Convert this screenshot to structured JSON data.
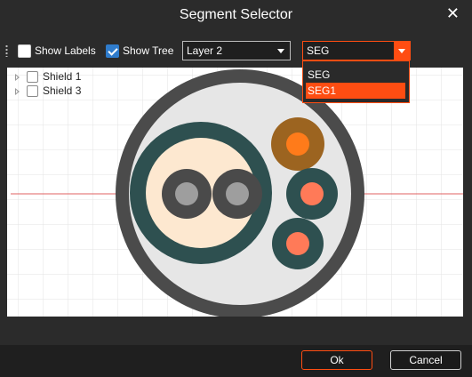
{
  "dialog": {
    "title": "Segment Selector"
  },
  "toolbar": {
    "show_labels": {
      "label": "Show Labels",
      "checked": false
    },
    "show_tree": {
      "label": "Show Tree",
      "checked": true
    },
    "layer_select": {
      "value": "Layer 2"
    },
    "segment_select": {
      "value": "SEG",
      "options": [
        "SEG",
        "SEG1"
      ],
      "highlighted": "SEG1"
    }
  },
  "tree": {
    "items": [
      {
        "label": "Shield 1",
        "checked": false
      },
      {
        "label": "Shield 3",
        "checked": false
      }
    ]
  },
  "footer": {
    "ok_label": "Ok",
    "cancel_label": "Cancel"
  },
  "colors": {
    "accent": "#ff4d12",
    "outer_jacket": "#4b4b4b",
    "inner_fill": "#e6e6e6",
    "shield_ring": "#2e5050",
    "pair_core_fill": "#fde8d0",
    "conductor_outer": "#4a4a4a",
    "conductor_inner": "#9e9e9e",
    "brown_ring": "#9c6420",
    "orange_core": "#ff7b1a",
    "salmon_core": "#ff7a58",
    "axis_line": "#e06060"
  }
}
